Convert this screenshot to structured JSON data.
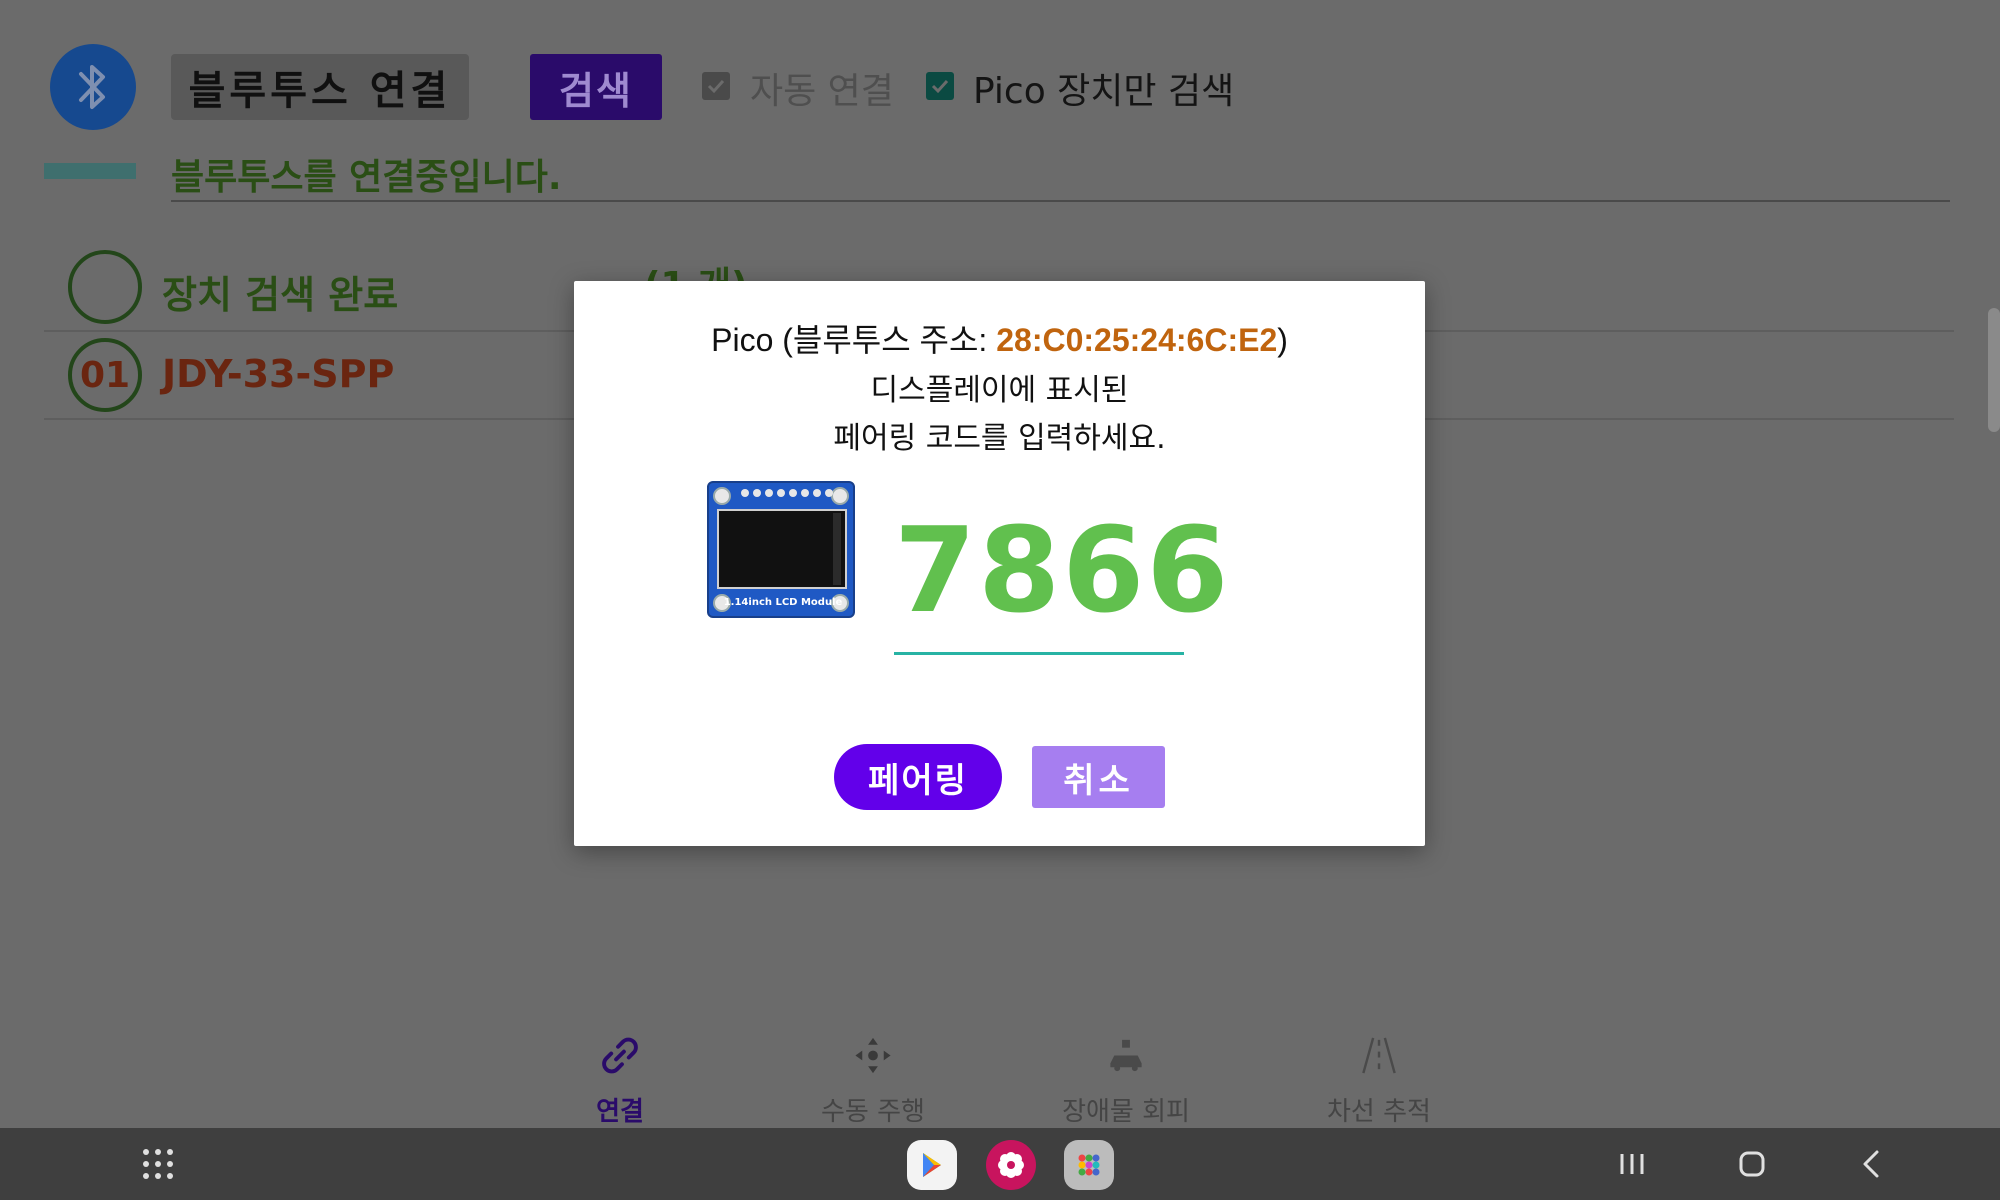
{
  "header": {
    "connect_button_label": "블루투스 연결",
    "search_button_label": "검색",
    "auto_connect_label": "자동 연결",
    "auto_connect_checked": true,
    "pico_only_label": "Pico 장치만 검색",
    "pico_only_checked": true,
    "bluetooth_icon": "bluetooth-icon"
  },
  "status": {
    "text": "블루투스를 연결중입니다."
  },
  "device_list": {
    "header_title": "장치 검색 완료",
    "header_count": "(1 개)",
    "items": [
      {
        "index": "01",
        "name": "JDY-33-SPP"
      }
    ]
  },
  "tabs": [
    {
      "label": "연결",
      "icon": "link-icon",
      "active": true
    },
    {
      "label": "수동 주행",
      "icon": "move-arrows-icon",
      "active": false
    },
    {
      "label": "장애물 회피",
      "icon": "car-obstacle-icon",
      "active": false
    },
    {
      "label": "차선 추적",
      "icon": "lane-road-icon",
      "active": false
    }
  ],
  "dialog": {
    "title_prefix": "Pico (블루투스 주소: ",
    "address": "28:C0:25:24:6C:E2",
    "title_suffix": ")",
    "message_line1": "디스플레이에 표시된",
    "message_line2": "페어링 코드를 입력하세요.",
    "lcd_label": "1.14inch LCD Module",
    "pairing_code": "7866",
    "pair_button_label": "페어링",
    "cancel_button_label": "취소"
  },
  "system_nav": {
    "apps_icon": "app-grid-icon",
    "dock": [
      "play-store-icon",
      "flower-app-icon",
      "app-folder-icon"
    ],
    "buttons": [
      "recent-apps-icon",
      "home-icon",
      "back-icon"
    ]
  },
  "colors": {
    "accent_purple": "#6200ea",
    "code_green": "#61c04e",
    "address_orange": "#c0640e",
    "underline_teal": "#27b3a4",
    "cancel_purple": "#a67ef0"
  }
}
